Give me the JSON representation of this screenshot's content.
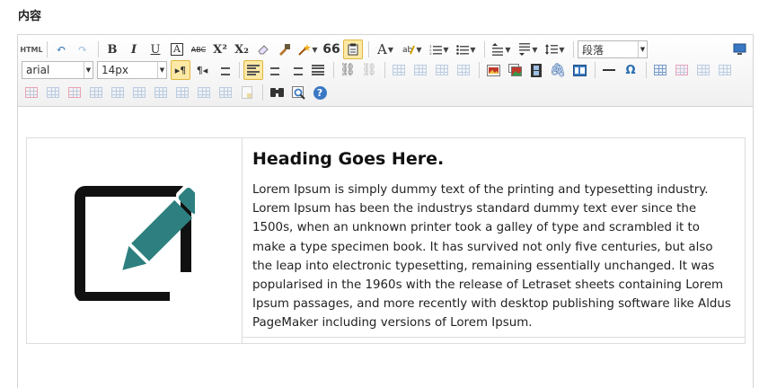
{
  "field": {
    "label": "内容"
  },
  "toolbar": {
    "source_label": "HTML",
    "bold": "B",
    "italic": "I",
    "underline": "U",
    "font_border": "A",
    "strike": "ABC",
    "superscript": "X²",
    "subscript": "X₂",
    "blockquote": "66",
    "font_color": "A",
    "paragraph_select": "段落",
    "font_family_select": "arial",
    "font_size_select": "14px",
    "omega": "Ω",
    "help": "?"
  },
  "document": {
    "heading": "Heading Goes Here.",
    "paragraph": "Lorem Ipsum is simply dummy text of the printing and typesetting industry. Lorem Ipsum has been the industrys standard dummy text ever since the 1500s, when an unknown printer took a galley of type and scrambled it to make a type specimen book. It has survived not only five centuries, but also the leap into electronic typesetting, remaining essentially unchanged. It was popularised in the 1960s with the release of Letraset sheets containing Lorem Ipsum passages, and more recently with desktop publishing software like Aldus PageMaker including versions of Lorem Ipsum.",
    "image_icon": "edit-pencil-icon"
  },
  "colors": {
    "pencil": "#2e8080",
    "highlight": "#fde9a6",
    "accent_blue": "#2b6fb3"
  }
}
